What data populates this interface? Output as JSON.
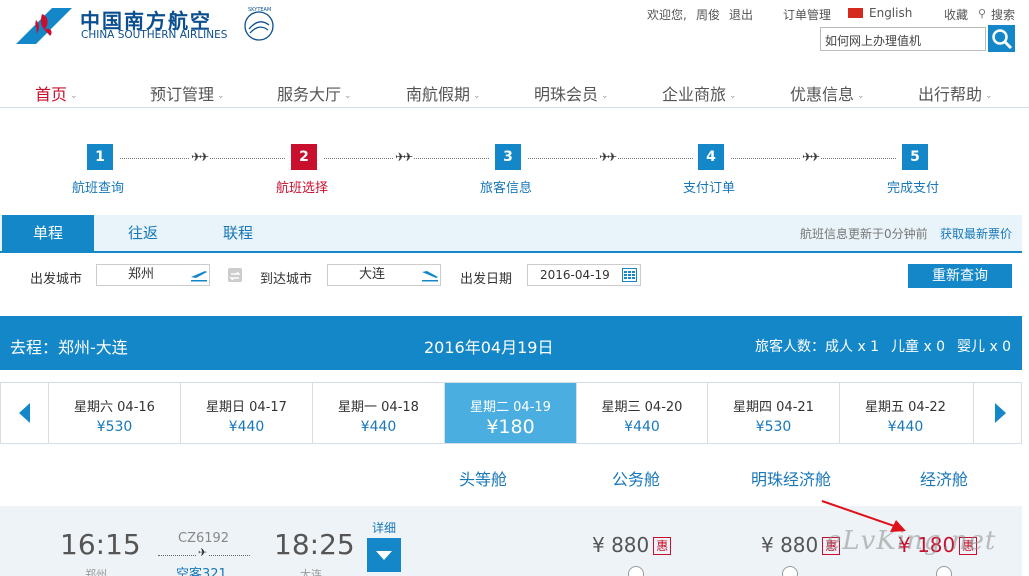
{
  "brand": {
    "name_cn": "中国南方航空",
    "name_en": "CHINA SOUTHERN AIRLINES",
    "skyteam": "SKYTEAM",
    "color": "#0b4f8e"
  },
  "toplinks": {
    "welcome": "欢迎您,",
    "user": "周俊",
    "logout": "退出",
    "orders": "订单管理",
    "language": "English",
    "favorite": "收藏",
    "search": "搜索"
  },
  "search": {
    "value": "如何网上办理值机"
  },
  "nav": [
    "首页",
    "预订管理",
    "服务大厅",
    "南航假期",
    "明珠会员",
    "企业商旅",
    "优惠信息",
    "出行帮助"
  ],
  "steps": [
    {
      "num": "1",
      "label": "航班查询"
    },
    {
      "num": "2",
      "label": "航班选择"
    },
    {
      "num": "3",
      "label": "旅客信息"
    },
    {
      "num": "4",
      "label": "支付订单"
    },
    {
      "num": "5",
      "label": "完成支付"
    }
  ],
  "tabs": [
    "单程",
    "往返",
    "联程"
  ],
  "update": {
    "text": "航班信息更新于0分钟前",
    "refresh": "获取最新票价"
  },
  "form": {
    "from_label": "出发城市",
    "from_value": "郑州",
    "to_label": "到达城市",
    "to_value": "大连",
    "date_label": "出发日期",
    "date_value": "2016-04-19",
    "requery": "重新查询"
  },
  "route": {
    "title": "去程：郑州-大连",
    "date": "2016年04月19日",
    "adult": "旅客人数：成人 x 1",
    "child": "儿童 x 0",
    "infant": "婴儿 x 0"
  },
  "days": [
    {
      "label": "星期六  04-16",
      "price": "¥530"
    },
    {
      "label": "星期日  04-17",
      "price": "¥440"
    },
    {
      "label": "星期一  04-18",
      "price": "¥440"
    },
    {
      "label": "星期二  04-19",
      "price": "¥180"
    },
    {
      "label": "星期三  04-20",
      "price": "¥440"
    },
    {
      "label": "星期四  04-21",
      "price": "¥530"
    },
    {
      "label": "星期五  04-22",
      "price": "¥440"
    }
  ],
  "cabins": [
    "头等舱",
    "公务舱",
    "明珠经济舱",
    "经济舱"
  ],
  "flight": {
    "dep_time": "16:15",
    "arr_time": "18:25",
    "flight_no": "CZ6192",
    "aircraft": "空客321",
    "dep_city": "郑州",
    "arr_city": "大连",
    "detail": "详细",
    "price_business": "¥ 880",
    "price_premium": "¥ 880",
    "price_economy": "¥ 180",
    "discount_mark": "惠"
  },
  "watermark": "eLvKing.net",
  "colors": {
    "primary": "#1487c8",
    "accent_red": "#c8102e",
    "light_bg": "#e8f4fa"
  }
}
